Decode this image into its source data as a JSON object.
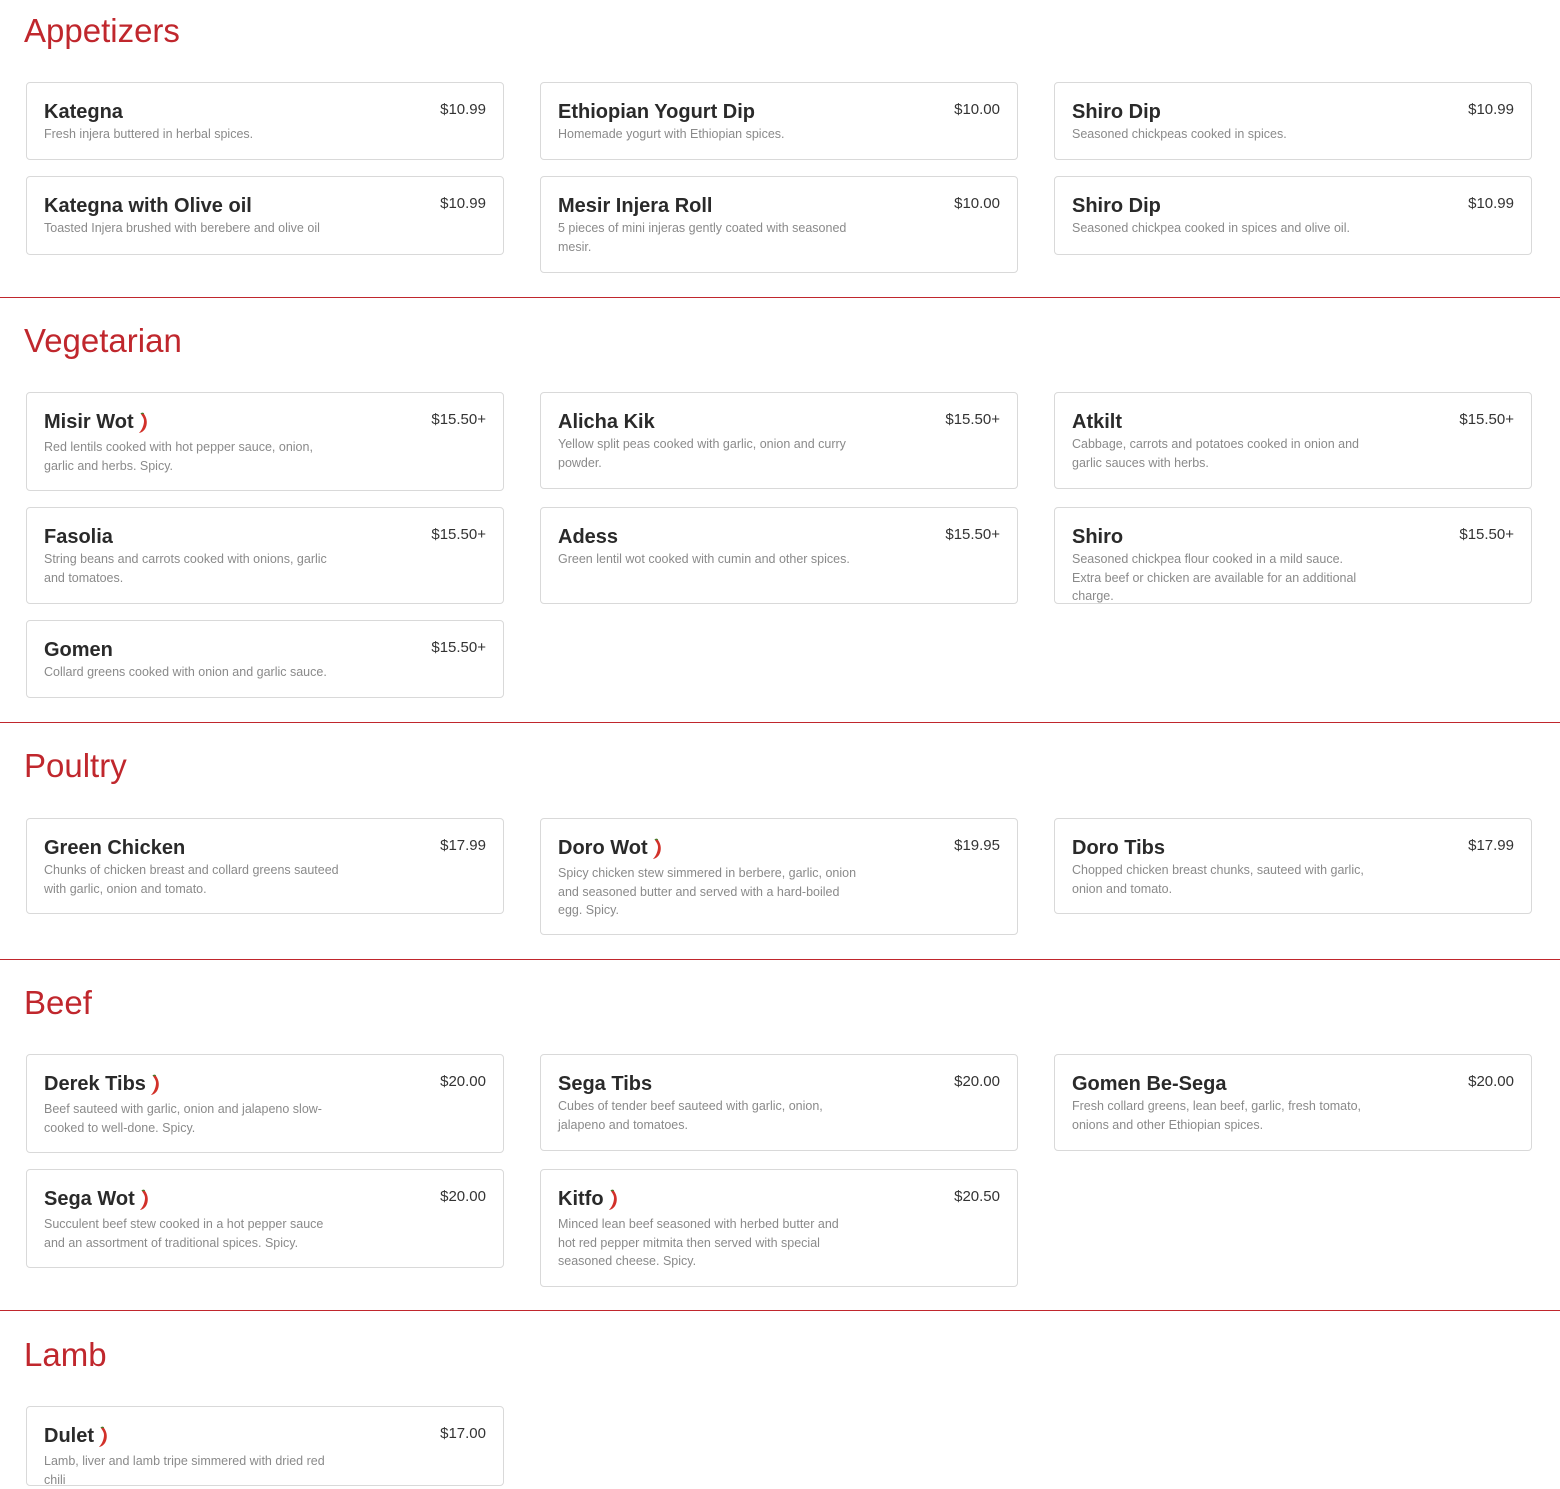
{
  "colors": {
    "accent": "#c0272d",
    "border": "#d9d9d9",
    "desc": "#8a8a8a"
  },
  "spicy_icon": "chili-pepper-icon",
  "sections": [
    {
      "title": "Appetizers",
      "items": [
        {
          "name": "Kategna",
          "price": "$10.99",
          "desc": "Fresh injera buttered in herbal spices.",
          "spicy": false
        },
        {
          "name": "Ethiopian Yogurt Dip",
          "price": "$10.00",
          "desc": "Homemade yogurt with Ethiopian spices.",
          "spicy": false
        },
        {
          "name": "Shiro Dip",
          "price": "$10.99",
          "desc": "Seasoned chickpeas cooked in spices.",
          "spicy": false
        },
        {
          "name": "Kategna with Olive oil",
          "price": "$10.99",
          "desc": "Toasted Injera brushed with berebere and olive oil",
          "spicy": false
        },
        {
          "name": "Mesir Injera Roll",
          "price": "$10.00",
          "desc": "5 pieces of mini injeras gently coated with seasoned mesir.",
          "spicy": false
        },
        {
          "name": "Shiro Dip",
          "price": "$10.99",
          "desc": "Seasoned chickpea cooked in spices and olive oil.",
          "spicy": false
        }
      ]
    },
    {
      "title": "Vegetarian",
      "items": [
        {
          "name": "Misir Wot",
          "price": "$15.50+",
          "desc": "Red lentils cooked with hot pepper sauce, onion, garlic and herbs. Spicy.",
          "spicy": true
        },
        {
          "name": "Alicha Kik",
          "price": "$15.50+",
          "desc": "Yellow split peas cooked with garlic, onion and curry powder.",
          "spicy": false
        },
        {
          "name": "Atkilt",
          "price": "$15.50+",
          "desc": "Cabbage, carrots and potatoes cooked in onion and garlic sauces with herbs.",
          "spicy": false
        },
        {
          "name": "Fasolia",
          "price": "$15.50+",
          "desc": "String beans and carrots cooked with onions, garlic and tomatoes.",
          "spicy": false
        },
        {
          "name": "Adess",
          "price": "$15.50+",
          "desc": "Green lentil wot cooked with cumin and other spices.",
          "spicy": false
        },
        {
          "name": "Shiro",
          "price": "$15.50+",
          "desc": "Seasoned chickpea flour cooked in a mild sauce. Extra beef or chicken are available for an additional charge.",
          "spicy": false
        },
        {
          "name": "Gomen",
          "price": "$15.50+",
          "desc": "Collard greens cooked with onion and garlic sauce.",
          "spicy": false
        }
      ]
    },
    {
      "title": "Poultry",
      "items": [
        {
          "name": "Green Chicken",
          "price": "$17.99",
          "desc": "Chunks of chicken breast and collard greens sauteed with garlic, onion and tomato.",
          "spicy": false
        },
        {
          "name": "Doro Wot",
          "price": "$19.95",
          "desc": "Spicy chicken stew simmered in berbere, garlic, onion and seasoned butter and served with a hard-boiled egg. Spicy.",
          "spicy": true
        },
        {
          "name": "Doro Tibs",
          "price": "$17.99",
          "desc": "Chopped chicken breast chunks, sauteed with garlic, onion and tomato.",
          "spicy": false
        }
      ]
    },
    {
      "title": "Beef",
      "items": [
        {
          "name": "Derek Tibs",
          "price": "$20.00",
          "desc": "Beef sauteed with garlic, onion and jalapeno slow-cooked to well-done. Spicy.",
          "spicy": true
        },
        {
          "name": "Sega Tibs",
          "price": "$20.00",
          "desc": "Cubes of tender beef sauteed with garlic, onion, jalapeno and tomatoes.",
          "spicy": false
        },
        {
          "name": "Gomen Be-Sega",
          "price": "$20.00",
          "desc": "Fresh collard greens, lean beef, garlic, fresh tomato, onions and other Ethiopian spices.",
          "spicy": false
        },
        {
          "name": "Sega Wot",
          "price": "$20.00",
          "desc": "Succulent beef stew cooked in a hot pepper sauce and an assortment of traditional spices. Spicy.",
          "spicy": true
        },
        {
          "name": "Kitfo",
          "price": "$20.50",
          "desc": "Minced lean beef seasoned with herbed butter and hot red pepper mitmita then served with special seasoned cheese. Spicy.",
          "spicy": true
        }
      ]
    },
    {
      "title": "Lamb",
      "items": [
        {
          "name": "Dulet",
          "price": "$17.00",
          "desc": "Lamb, liver and lamb tripe simmered with dried red chili",
          "spicy": true
        }
      ]
    }
  ]
}
